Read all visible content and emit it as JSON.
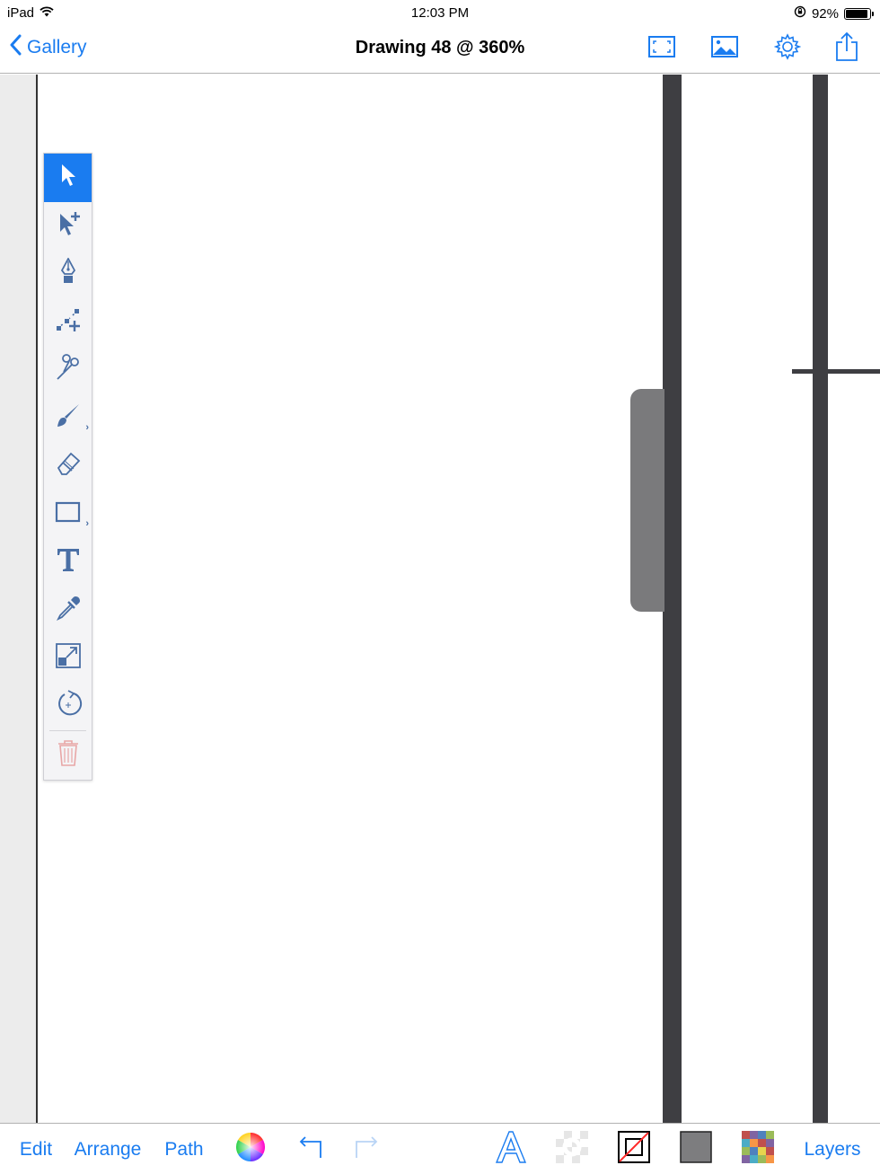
{
  "status_bar": {
    "device": "iPad",
    "time": "12:03 PM",
    "battery_text": "92%",
    "battery_level": 0.92
  },
  "nav": {
    "back_label": "Gallery",
    "title": "Drawing 48 @ 360%",
    "icons": [
      "fullscreen-icon",
      "image-icon",
      "gear-icon",
      "share-icon"
    ]
  },
  "tools": [
    {
      "name": "select-tool",
      "icon": "arrow-cursor-icon",
      "active": true
    },
    {
      "name": "subselect-tool",
      "icon": "arrow-plus-icon"
    },
    {
      "name": "pen-tool",
      "icon": "pen-nib-icon"
    },
    {
      "name": "add-anchor-tool",
      "icon": "node-plus-icon"
    },
    {
      "name": "scissors-tool",
      "icon": "scissors-icon"
    },
    {
      "name": "brush-tool",
      "icon": "brush-icon",
      "more": true
    },
    {
      "name": "eraser-tool",
      "icon": "eraser-icon"
    },
    {
      "name": "shape-tool",
      "icon": "rectangle-icon",
      "more": true
    },
    {
      "name": "text-tool",
      "icon": "text-t-icon"
    },
    {
      "name": "eyedropper-tool",
      "icon": "eyedropper-icon"
    },
    {
      "name": "scale-tool",
      "icon": "scale-icon"
    },
    {
      "name": "rotate-tool",
      "icon": "rotate-icon"
    },
    {
      "name": "delete-tool",
      "icon": "trash-icon"
    }
  ],
  "bottom_bar": {
    "edit_label": "Edit",
    "arrange_label": "Arrange",
    "path_label": "Path",
    "layers_label": "Layers"
  },
  "colors": {
    "accent": "#1a7cf0",
    "shape": "#3e3e42",
    "handle": "#7a7a7c",
    "fill_swatch": "#7d7d7f"
  }
}
